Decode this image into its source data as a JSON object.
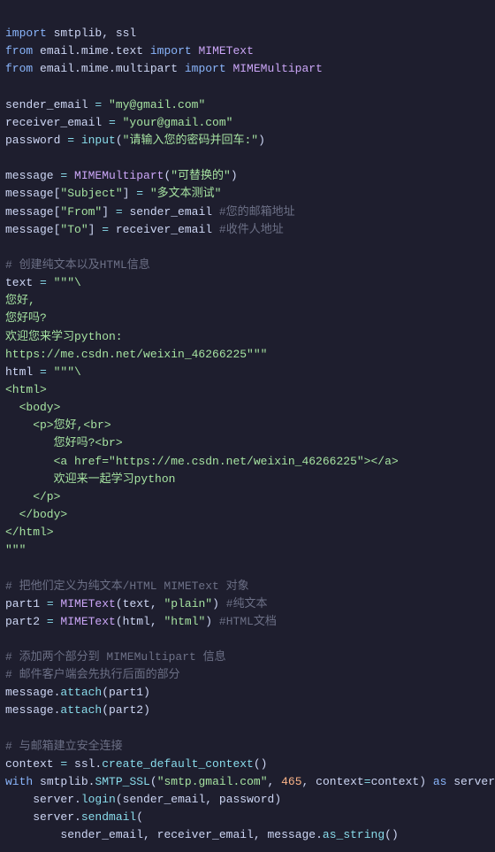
{
  "code": {
    "lines": []
  }
}
